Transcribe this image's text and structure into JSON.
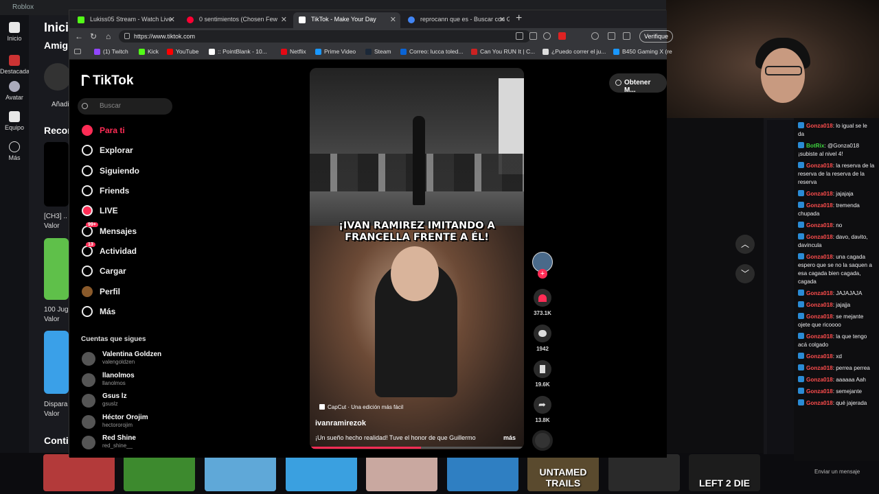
{
  "roblox": {
    "title": "Roblox",
    "nav": [
      {
        "label": "Inicio"
      },
      {
        "label": "Destacadas"
      },
      {
        "label": "Avatar"
      },
      {
        "label": "Equipo"
      },
      {
        "label": "Más"
      }
    ],
    "home_partial": "Inici",
    "friends_partial": "Amig",
    "add_partial": "Añadi",
    "recommended_partial": "Recor",
    "continue_partial": "Conti",
    "tiles": [
      {
        "name": "[CH3] ..",
        "rating": "Valor"
      },
      {
        "name": "100 Jug",
        "rating": "Valor"
      },
      {
        "name": "Dispara",
        "rating": "Valor"
      }
    ],
    "games": [
      {
        "label": "",
        "color": "#b33a3a"
      },
      {
        "label": "",
        "color": "#3d8a2e"
      },
      {
        "label": "",
        "color": "#5fa8d8"
      },
      {
        "label": "",
        "color": "#3aa0e0"
      },
      {
        "label": "",
        "color": "#c9a8a0"
      },
      {
        "label": "",
        "color": "#2f7fc2"
      },
      {
        "label": "UNTAMED TRAILS",
        "color": "#5a4a2e"
      },
      {
        "label": "",
        "color": "#2a2a2a"
      },
      {
        "label": "LEFT 2 DIE",
        "color": "#1c1c1c"
      }
    ]
  },
  "browser": {
    "tabs": [
      {
        "title": "Lukiss05 Stream - Watch Live",
        "icon": "kick-icon",
        "color": "#53fc18"
      },
      {
        "title": "0 sentimientos (Chosen Few",
        "icon": "youtube-music-icon",
        "color": "#ff0033"
      },
      {
        "title": "TikTok - Make Your Day",
        "icon": "tiktok-icon",
        "color": "#ffffff"
      },
      {
        "title": "reprocann que es - Buscar con Go",
        "icon": "google-icon",
        "color": "#4285f4"
      }
    ],
    "url": "https://www.tiktok.com",
    "verify_label": "Verifique",
    "bookmarks": [
      {
        "label": "(1) Twitch",
        "color": "#9146ff"
      },
      {
        "label": "Kick",
        "color": "#53fc18"
      },
      {
        "label": "YouTube",
        "color": "#ff0000"
      },
      {
        "label": ":: PointBlank - 10...",
        "color": "#ffffff"
      },
      {
        "label": "Netflix",
        "color": "#e50914"
      },
      {
        "label": "Prime Video",
        "color": "#1a98ff"
      },
      {
        "label": "Steam",
        "color": "#1b2838"
      },
      {
        "label": "Correo: lucca toled...",
        "color": "#0a64d6"
      },
      {
        "label": "Can You RUN It | C...",
        "color": "#cc2222"
      },
      {
        "label": "¿Puedo correr el ju...",
        "color": "#dddddd"
      },
      {
        "label": "B450 Gaming X (re",
        "color": "#1a98ff"
      }
    ]
  },
  "tiktok": {
    "logo": "TikTok",
    "search_placeholder": "Buscar",
    "nav": [
      {
        "label": "Para ti",
        "icon": "home-icon"
      },
      {
        "label": "Explorar",
        "icon": "compass-icon"
      },
      {
        "label": "Siguiendo",
        "icon": "following-icon"
      },
      {
        "label": "Friends",
        "icon": "friends-icon"
      },
      {
        "label": "LIVE",
        "icon": "live-icon"
      },
      {
        "label": "Mensajes",
        "icon": "messages-icon",
        "badge": "99+"
      },
      {
        "label": "Actividad",
        "icon": "activity-icon",
        "badge": "13"
      },
      {
        "label": "Cargar",
        "icon": "upload-icon"
      },
      {
        "label": "Perfil",
        "icon": "profile-icon"
      },
      {
        "label": "Más",
        "icon": "more-icon"
      }
    ],
    "following_title": "Cuentas que sigues",
    "accounts": [
      {
        "name": "Valentina Goldzen",
        "handle": "valengoldzen"
      },
      {
        "name": "llanolmos",
        "handle": "llanolmos"
      },
      {
        "name": "Gsus lz",
        "handle": "gsuslz"
      },
      {
        "name": "Héctor Orojim",
        "handle": "hectororojim"
      },
      {
        "name": "Red Shine",
        "handle": "red_shine__"
      }
    ],
    "get_app": "Obtener M...",
    "video": {
      "caption": "¡IVAN RAMIREZ IMITANDO A FRANCELLA FRENTE A  ÉL!",
      "capcut": "CapCut · Una edición más fácil",
      "author": "ivanramirezok",
      "description": "¡Un sueño hecho realidad! Tuve el honor de que Guillermo",
      "more": "más",
      "progress": 0.52
    },
    "actions": {
      "likes": "373.1K",
      "comments": "1942",
      "saves": "19.6K",
      "shares": "13.8K"
    }
  },
  "chat": {
    "messages": [
      {
        "user": "Gonza018",
        "text": "lo igual se le da"
      },
      {
        "user": "BotRix",
        "text": "@Gonza018 ¡subiste al nivel 4!",
        "bot": true
      },
      {
        "user": "Gonza018",
        "text": "la reserva de la reserva de la reserva de la reserva"
      },
      {
        "user": "Gonza018",
        "text": "jajajaja"
      },
      {
        "user": "Gonza018",
        "text": "tremenda chupada"
      },
      {
        "user": "Gonza018",
        "text": "no"
      },
      {
        "user": "Gonza018",
        "text": "davo, davito, davincula"
      },
      {
        "user": "Gonza018",
        "text": "una cagada espero que se no la saquen a esa cagada bien cagada, cagada"
      },
      {
        "user": "Gonza018",
        "text": "JAJAJAJA"
      },
      {
        "user": "Gonza018",
        "text": "jajajja"
      },
      {
        "user": "Gonza018",
        "text": "se mejante ojete que ricoooo"
      },
      {
        "user": "Gonza018",
        "text": "la que tengo acá colgado"
      },
      {
        "user": "Gonza018",
        "text": "xd"
      },
      {
        "user": "Gonza018",
        "text": "perrea perrea"
      },
      {
        "user": "Gonza018",
        "text": "aaaaaa Aah"
      },
      {
        "user": "Gonza018",
        "text": "semejante"
      },
      {
        "user": "Gonza018",
        "text": "qué jajerada"
      }
    ],
    "send_label": "Enviar un mensaje"
  }
}
